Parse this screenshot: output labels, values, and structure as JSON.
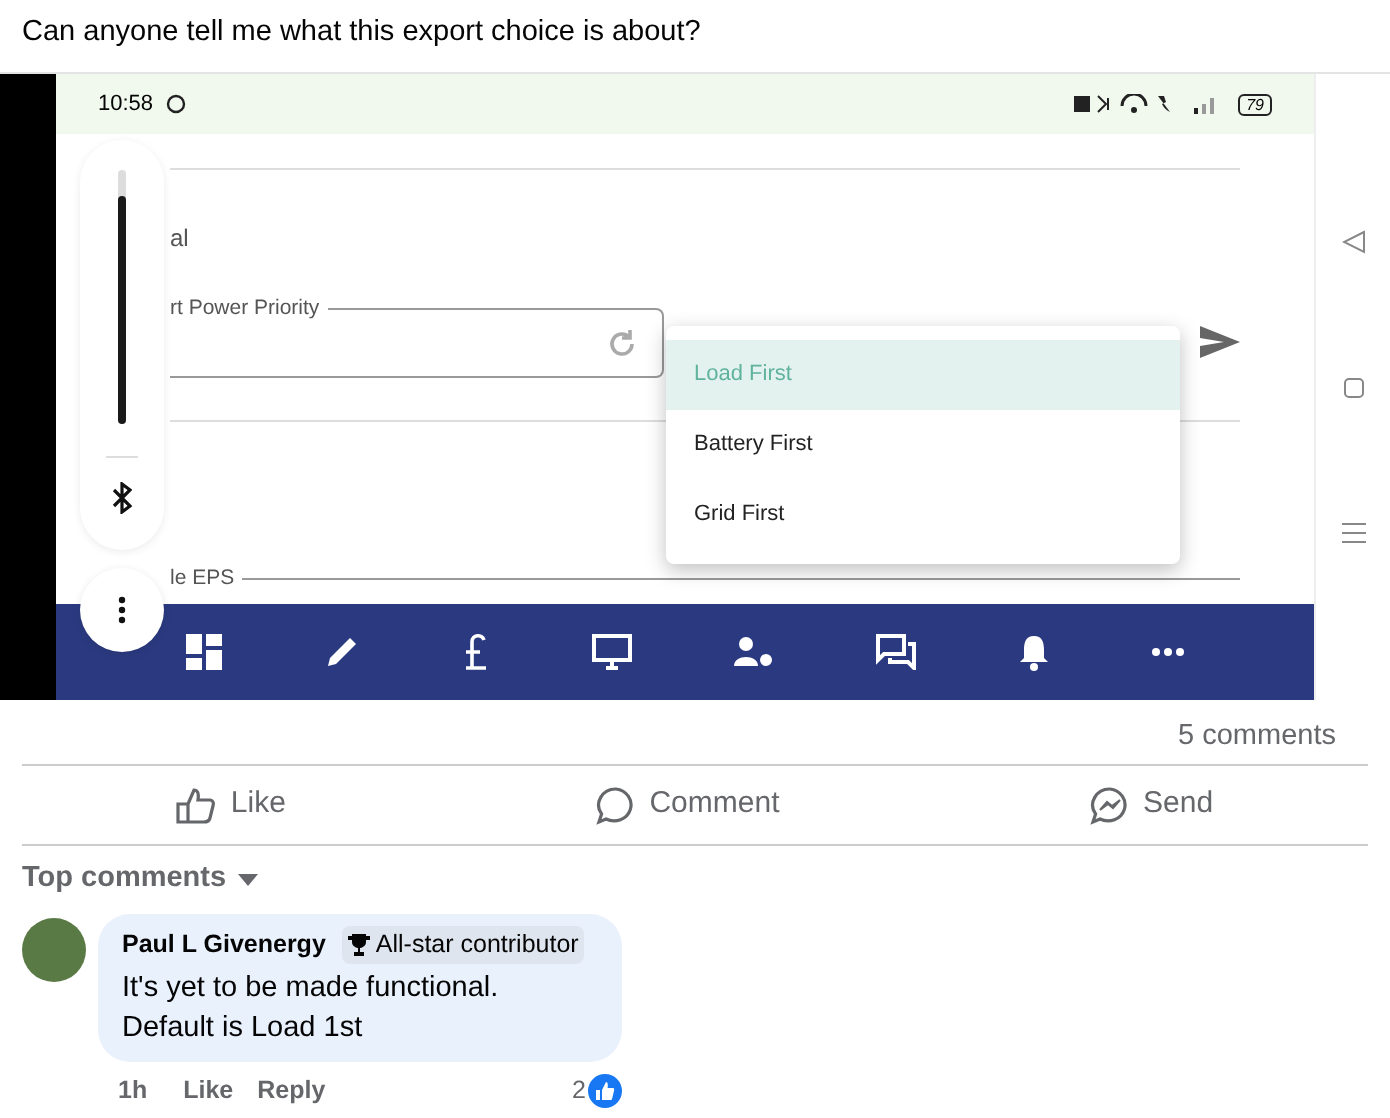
{
  "post": {
    "text": "Can anyone tell me what this export choice is about?"
  },
  "screenshot": {
    "status_bar": {
      "time": "10:58",
      "battery": "79"
    },
    "section_title": "al",
    "priority_field": {
      "label": "rt Power Priority"
    },
    "dropdown": [
      {
        "label": "Load First",
        "selected": true
      },
      {
        "label": "Battery First",
        "selected": false
      },
      {
        "label": "Grid First",
        "selected": false
      }
    ],
    "eps_field": {
      "label": "le EPS"
    },
    "volume_slider": {
      "level": 0.9
    }
  },
  "comment_count": "5 comments",
  "actions": [
    {
      "kind": "like",
      "label": "Like"
    },
    {
      "kind": "comment",
      "label": "Comment"
    },
    {
      "kind": "send",
      "label": "Send"
    }
  ],
  "sort": {
    "label": "Top comments"
  },
  "comments": [
    {
      "author": "Paul L Givenergy",
      "badge": "All-star contributor",
      "lines": [
        "It's yet to be made functional.",
        "Default is Load 1st"
      ],
      "time": "1h",
      "like": "Like",
      "reply": "Reply",
      "reactions": "2"
    }
  ]
}
